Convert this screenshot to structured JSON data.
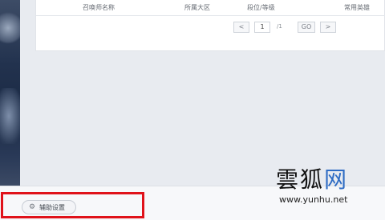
{
  "table": {
    "columns": [
      "召唤师名称",
      "所属大区",
      "段位/等级",
      "常用英雄"
    ]
  },
  "pager": {
    "prev_icon": "<",
    "current_page": "1",
    "total_pages": "/1",
    "go_label": "GO",
    "next_icon": ">"
  },
  "footer": {
    "assist_button_label": "辅助设置",
    "assist_icon": "gear-icon",
    "highlight_color": "#e0121a"
  },
  "watermark": {
    "brand": "雲狐",
    "brand_suffix": "网",
    "url": "www.yunhu.net"
  }
}
